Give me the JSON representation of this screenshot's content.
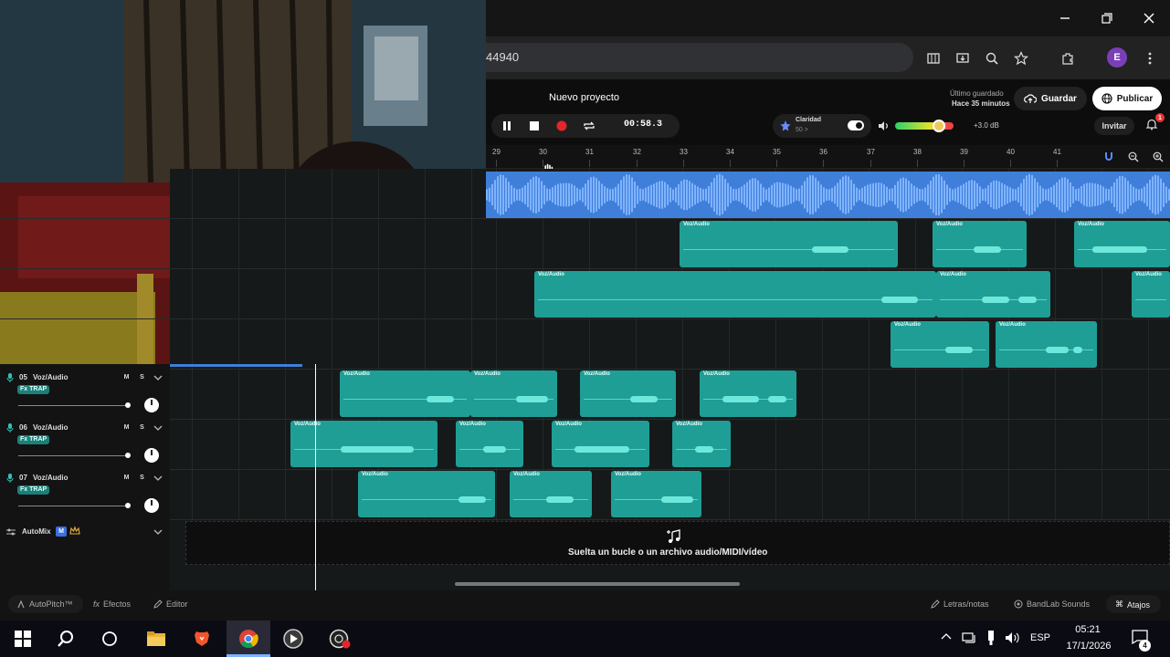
{
  "browser": {
    "url_text": "44940",
    "avatar_letter": "E"
  },
  "header": {
    "project_name": "Nuevo proyecto",
    "last_saved_label": "Último guardado",
    "last_saved_time": "Hace 35 minutos",
    "save_label": "Guardar",
    "publish_label": "Publicar",
    "invite_label": "Invitar",
    "notification_count": "1"
  },
  "transport": {
    "timecode": "00:58.3",
    "clarity_label": "Claridad",
    "clarity_value": "50 >",
    "volume_db": "+3.0 dB"
  },
  "ruler": {
    "bars": [
      "29",
      "30",
      "31",
      "32",
      "33",
      "34",
      "35",
      "36",
      "37",
      "38",
      "39",
      "40",
      "41"
    ]
  },
  "clip_label": "Voz/Audio",
  "tracks": [
    {
      "number": "05",
      "name": "Voz/Audio",
      "tag": "Fx TRAP",
      "mute": "M",
      "solo": "S"
    },
    {
      "number": "06",
      "name": "Voz/Audio",
      "tag": "Fx TRAP",
      "mute": "M",
      "solo": "S"
    },
    {
      "number": "07",
      "name": "Voz/Audio",
      "tag": "Fx TRAP",
      "mute": "M",
      "solo": "S"
    }
  ],
  "automix_label": "AutoMix",
  "dropzone_text": "Suelta un bucle o un archivo audio/MIDI/vídeo",
  "bottom_bar": {
    "autopitch": "AutoPitch™",
    "effects": "Efectos",
    "editor": "Editor",
    "lyrics": "Letras/notas",
    "sounds": "BandLab Sounds",
    "shortcuts": "Atajos"
  },
  "taskbar": {
    "language": "ESP",
    "time": "05:21",
    "date": "17/1/2026",
    "notifications": "4"
  },
  "colors": {
    "clip": "#1f9e96",
    "master_track": "#3f7fd9",
    "record": "#e5252a"
  }
}
